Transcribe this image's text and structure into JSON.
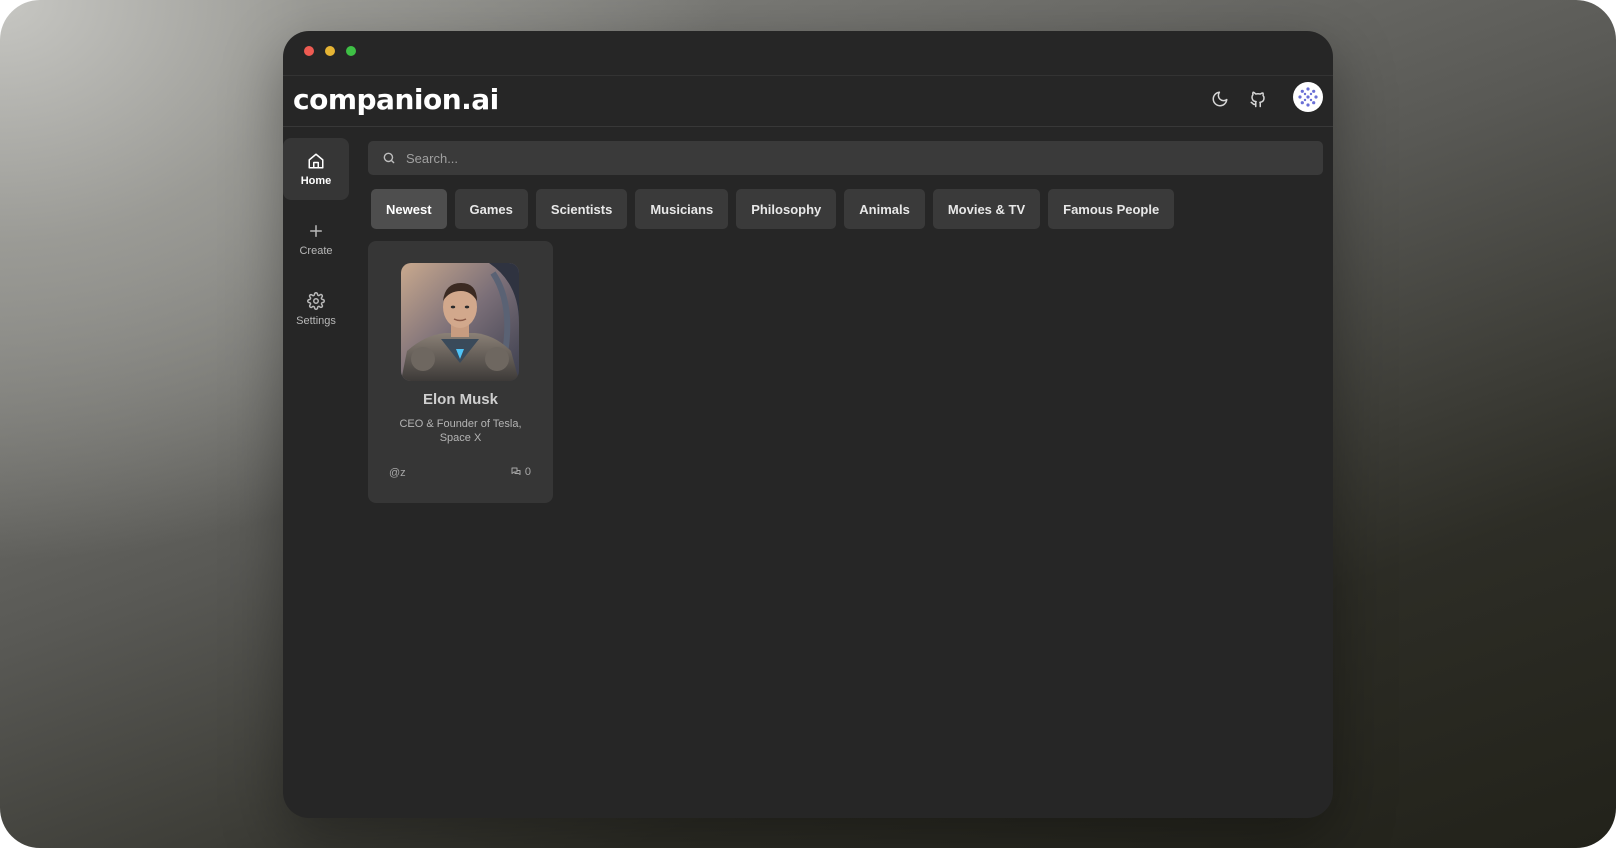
{
  "app": {
    "logo": "companion.ai"
  },
  "header": {
    "icons": [
      "moon-icon",
      "github-icon",
      "user-avatar-icon"
    ]
  },
  "sidebar": {
    "items": [
      {
        "label": "Home",
        "icon": "home-icon",
        "active": true
      },
      {
        "label": "Create",
        "icon": "plus-icon",
        "active": false
      },
      {
        "label": "Settings",
        "icon": "gear-icon",
        "active": false
      }
    ]
  },
  "search": {
    "placeholder": "Search..."
  },
  "categories": [
    {
      "label": "Newest",
      "active": true
    },
    {
      "label": "Games"
    },
    {
      "label": "Scientists"
    },
    {
      "label": "Musicians"
    },
    {
      "label": "Philosophy"
    },
    {
      "label": "Animals"
    },
    {
      "label": "Movies & TV"
    },
    {
      "label": "Famous People"
    }
  ],
  "companions": [
    {
      "name": "Elon Musk",
      "description": "CEO & Founder of Tesla, Space X",
      "creator": "@z",
      "message_count": "0"
    }
  ],
  "colors": {
    "window_bg": "#262626",
    "card_bg": "#363636",
    "chip_bg": "#3a3a3a",
    "chip_active_bg": "#4e4e4e"
  }
}
